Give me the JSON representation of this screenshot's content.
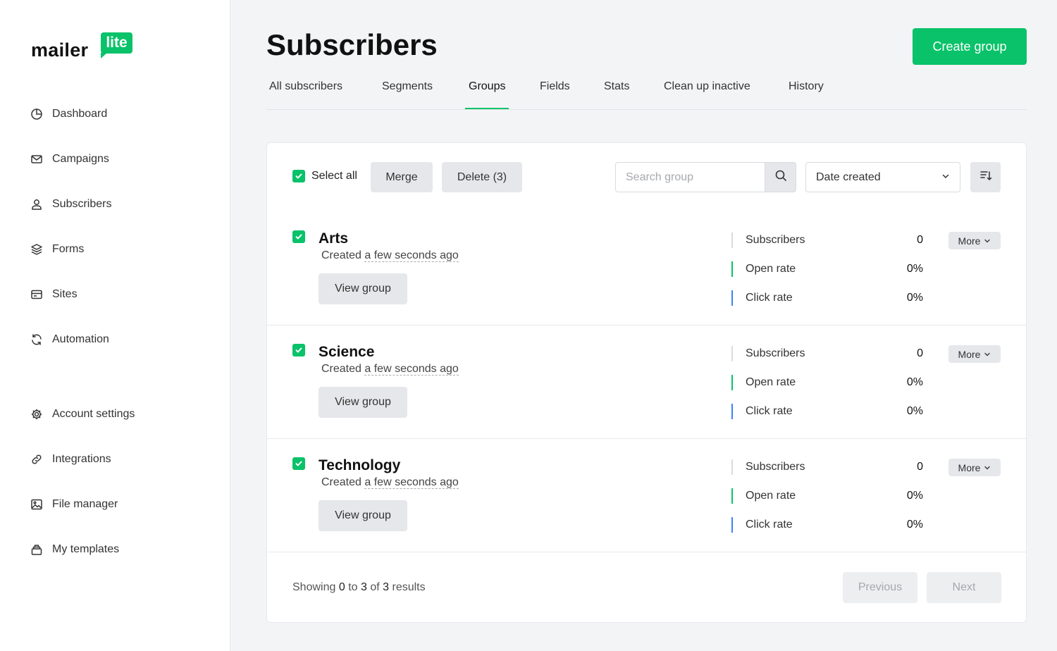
{
  "brand": {
    "word": "mailer",
    "badge": "lite",
    "accent": "#09c269"
  },
  "sidebar": {
    "items": [
      {
        "label": "Dashboard",
        "icon": "pie-chart-icon"
      },
      {
        "label": "Campaigns",
        "icon": "mail-icon"
      },
      {
        "label": "Subscribers",
        "icon": "user-icon"
      },
      {
        "label": "Forms",
        "icon": "layers-icon"
      },
      {
        "label": "Sites",
        "icon": "browser-icon"
      },
      {
        "label": "Automation",
        "icon": "refresh-icon"
      },
      {
        "label": "Account settings",
        "icon": "gear-icon"
      },
      {
        "label": "Integrations",
        "icon": "link-icon"
      },
      {
        "label": "File manager",
        "icon": "image-icon"
      },
      {
        "label": "My templates",
        "icon": "templates-icon"
      }
    ]
  },
  "header": {
    "title": "Subscribers",
    "create_label": "Create group"
  },
  "tabs": [
    {
      "label": "All subscribers"
    },
    {
      "label": "Segments"
    },
    {
      "label": "Groups",
      "active": true
    },
    {
      "label": "Fields"
    },
    {
      "label": "Stats"
    },
    {
      "label": "Clean up inactive"
    },
    {
      "label": "History"
    }
  ],
  "toolbar": {
    "select_all_label": "Select all",
    "merge_label": "Merge",
    "delete_label": "Delete (3)",
    "search_placeholder": "Search group",
    "sort_value": "Date created"
  },
  "groups": [
    {
      "name": "Arts",
      "created_prefix": "Created",
      "created_ago": "a few seconds ago",
      "view_label": "View group",
      "more_label": "More",
      "stats": [
        {
          "label": "Subscribers",
          "value": "0"
        },
        {
          "label": "Open rate",
          "value": "0%"
        },
        {
          "label": "Click rate",
          "value": "0%"
        }
      ]
    },
    {
      "name": "Science",
      "created_prefix": "Created",
      "created_ago": "a few seconds ago",
      "view_label": "View group",
      "more_label": "More",
      "stats": [
        {
          "label": "Subscribers",
          "value": "0"
        },
        {
          "label": "Open rate",
          "value": "0%"
        },
        {
          "label": "Click rate",
          "value": "0%"
        }
      ]
    },
    {
      "name": "Technology",
      "created_prefix": "Created",
      "created_ago": "a few seconds ago",
      "view_label": "View group",
      "more_label": "More",
      "stats": [
        {
          "label": "Subscribers",
          "value": "0"
        },
        {
          "label": "Open rate",
          "value": "0%"
        },
        {
          "label": "Click rate",
          "value": "0%"
        }
      ]
    }
  ],
  "stat_colors": [
    "#d9dbdf",
    "#09c269",
    "#3b82f6"
  ],
  "pagination": {
    "showing": "Showing",
    "from": "0",
    "to_word": "to",
    "to": "3",
    "of_word": "of",
    "total": "3",
    "results_word": "results",
    "previous_label": "Previous",
    "next_label": "Next"
  }
}
